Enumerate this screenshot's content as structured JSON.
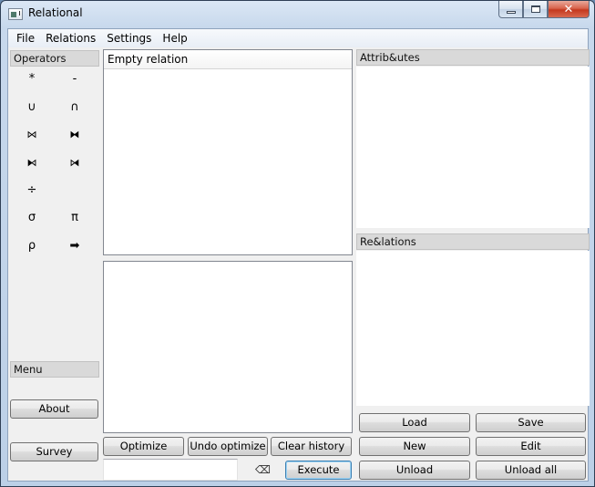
{
  "window": {
    "title": "Relational",
    "icon": "app-window-icon",
    "controls": {
      "minimize": "minimize-icon",
      "maximize": "maximize-icon",
      "close": "✕"
    }
  },
  "menubar": {
    "items": [
      "File",
      "Relations",
      "Settings",
      "Help"
    ]
  },
  "operators_dock": {
    "title": "Operators",
    "operators": [
      {
        "symbol": "*",
        "name": "product"
      },
      {
        "symbol": "-",
        "name": "difference"
      },
      {
        "symbol": "∪",
        "name": "union"
      },
      {
        "symbol": "∩",
        "name": "intersection"
      },
      {
        "symbol": "⋈",
        "name": "natural-join"
      },
      {
        "symbol": "⧓",
        "name": "outer-join"
      },
      {
        "symbol": "⧑",
        "name": "left-outer-join"
      },
      {
        "symbol": "⧒",
        "name": "right-outer-join"
      },
      {
        "symbol": "÷",
        "name": "division"
      },
      {
        "symbol": "σ",
        "name": "selection"
      },
      {
        "symbol": "π",
        "name": "projection"
      },
      {
        "symbol": "ρ",
        "name": "rename"
      },
      {
        "symbol": "➡",
        "name": "assignment"
      }
    ]
  },
  "menu_dock": {
    "title": "Menu",
    "about_label": "About",
    "survey_label": "Survey"
  },
  "result_panel": {
    "header": "Empty relation"
  },
  "history_panel": {
    "optimize_label": "Optimize",
    "undo_optimize_label": "Undo optimize",
    "clear_history_label": "Clear history"
  },
  "query": {
    "value": "",
    "clear_icon": "⌫",
    "execute_label": "Execute"
  },
  "attributes_dock": {
    "title": "Attrib&utes"
  },
  "relations_dock": {
    "title": "Re&lations",
    "load_label": "Load",
    "save_label": "Save",
    "new_label": "New",
    "edit_label": "Edit",
    "unload_label": "Unload",
    "unload_all_label": "Unload all"
  }
}
